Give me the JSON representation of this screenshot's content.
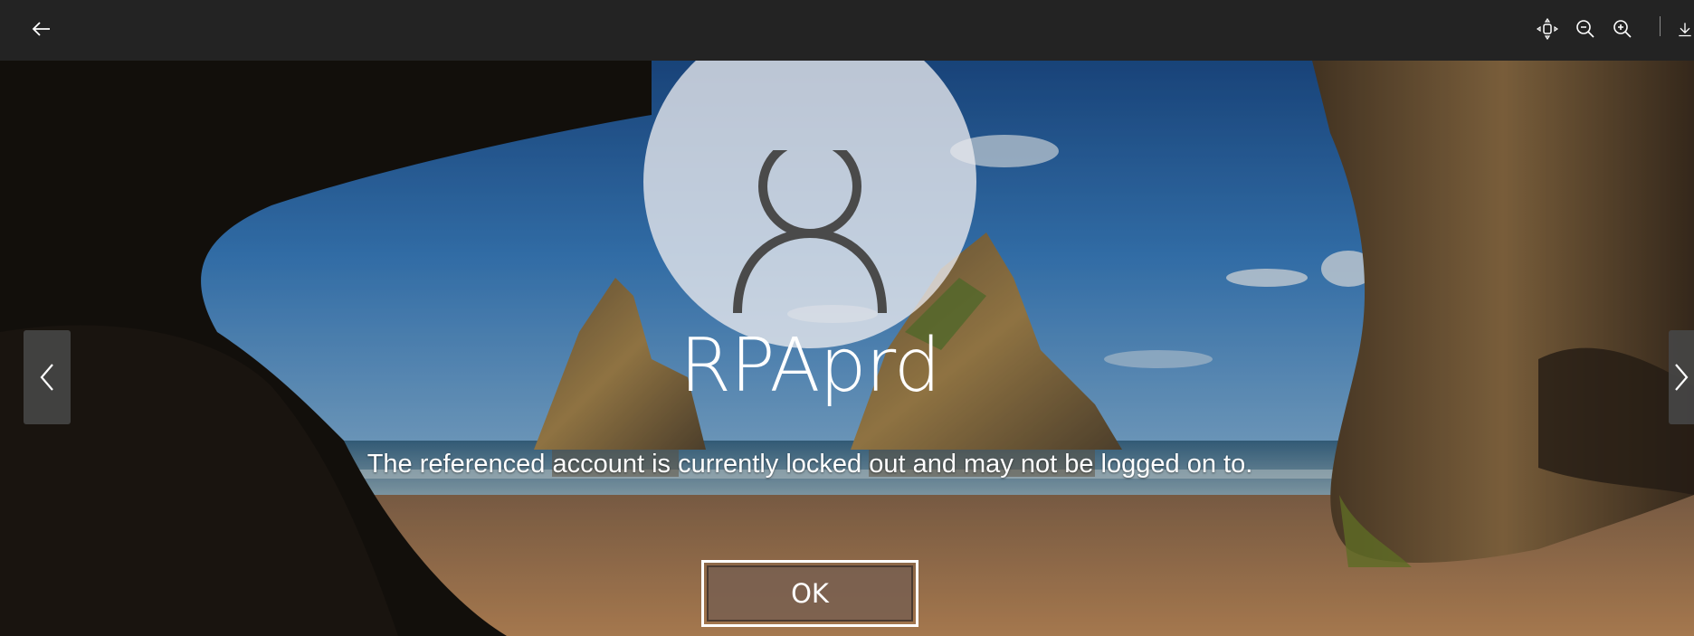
{
  "toolbar": {
    "back": "back-arrow-icon",
    "fit": "fit-to-window-icon",
    "zoom_out": "zoom-out-icon",
    "zoom_in": "zoom-in-icon",
    "download": "download-icon"
  },
  "lock_screen": {
    "username": "RPAprd",
    "message": "The referenced account is currently locked out and may not be logged on to.",
    "ok_label": "OK"
  },
  "navigation": {
    "previous": "chevron-left-icon",
    "next": "chevron-right-icon"
  },
  "colors": {
    "toolbar_bg": "#232323",
    "sky": "#2e6db0",
    "cave": "#1a1714",
    "sand": "#b07f55"
  }
}
